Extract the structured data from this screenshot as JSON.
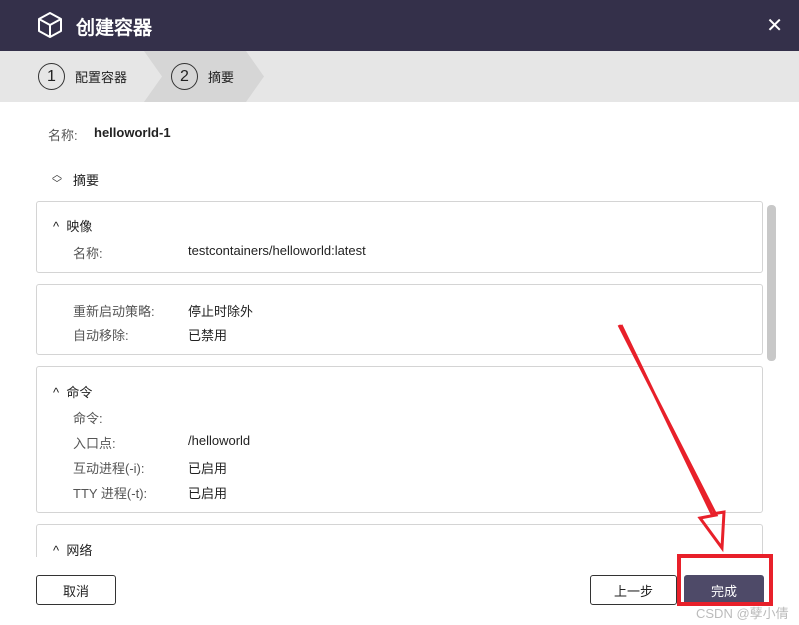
{
  "title": "创建容器",
  "steps": [
    {
      "num": "1",
      "label": "配置容器"
    },
    {
      "num": "2",
      "label": "摘要"
    }
  ],
  "name_label": "名称:",
  "name_value": "helloworld-1",
  "summary_toggle": "摘要",
  "sections": {
    "image": {
      "title": "映像",
      "rows": [
        {
          "label": "名称:",
          "value": "testcontainers/helloworld:latest"
        }
      ]
    },
    "restart": {
      "rows": [
        {
          "label": "重新启动策略:",
          "value": "停止时除外"
        },
        {
          "label": "自动移除:",
          "value": "已禁用"
        }
      ]
    },
    "command": {
      "title": "命令",
      "rows": [
        {
          "label": "命令:",
          "value": ""
        },
        {
          "label": "入口点:",
          "value": "/helloworld"
        },
        {
          "label": "互动进程(-i):",
          "value": "已启用"
        },
        {
          "label": "TTY 进程(-t):",
          "value": "已启用"
        }
      ]
    },
    "network": {
      "title": "网络"
    }
  },
  "buttons": {
    "cancel": "取消",
    "back": "上一步",
    "finish": "完成"
  },
  "watermark": "CSDN @孽小倩",
  "colors": {
    "titlebar": "#34304a",
    "primary": "#4e4a68",
    "annotation": "#e8202a"
  }
}
